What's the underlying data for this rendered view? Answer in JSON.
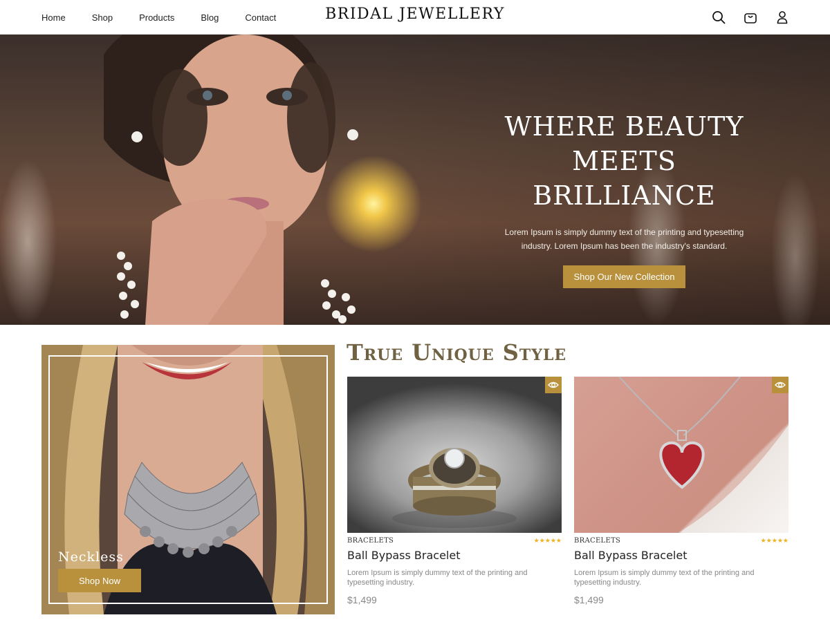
{
  "header": {
    "nav": [
      "Home",
      "Shop",
      "Products",
      "Blog",
      "Contact"
    ],
    "logo": "BRIDAL JEWELLERY",
    "icons": [
      "search-icon",
      "bag-icon",
      "user-icon"
    ]
  },
  "hero": {
    "title_line1": "WHERE BEAUTY",
    "title_line2": "MEETS BRILLIANCE",
    "subtitle_line1": "Lorem Ipsum is simply dummy text of the printing and typesetting",
    "subtitle_line2": "industry. Lorem Ipsum has been the industry's standard.",
    "button": "Shop Our New Collection"
  },
  "feature": {
    "label": "Neckless",
    "button": "Shop Now"
  },
  "section": {
    "title": "True Unique Style"
  },
  "products": [
    {
      "category": "BRACELETS",
      "name": "Ball Bypass Bracelet",
      "description": "Lorem Ipsum is simply dummy text of the printing and typesetting industry.",
      "price": "$1,499",
      "rating": 5,
      "stars": "★★★★★"
    },
    {
      "category": "BRACELETS",
      "name": "Ball Bypass Bracelet",
      "description": "Lorem Ipsum is simply dummy text of the printing and typesetting industry.",
      "price": "$1,499",
      "rating": 5,
      "stars": "★★★★★"
    }
  ],
  "colors": {
    "accent": "#b9913c",
    "section_title": "#6f6141",
    "star": "#f2b01e"
  }
}
